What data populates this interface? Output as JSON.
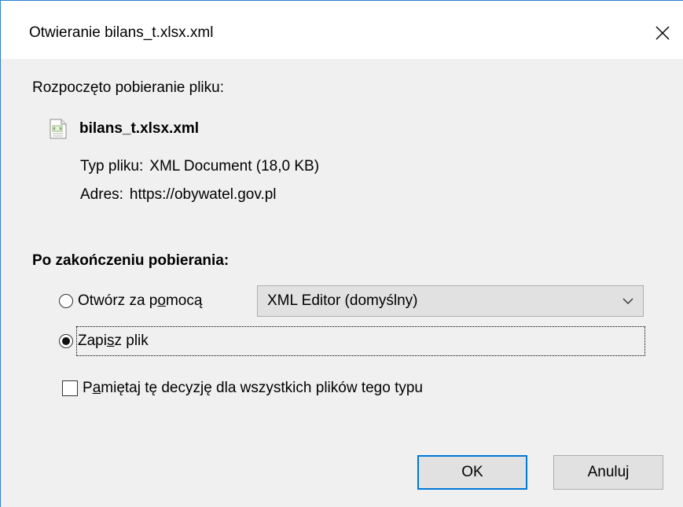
{
  "window": {
    "title": "Otwieranie bilans_t.xlsx.xml",
    "accent_color": "#0078d7"
  },
  "download": {
    "started_label": "Rozpoczęto pobieranie pliku:",
    "file_icon": "xml-file-icon",
    "file_name": "bilans_t.xlsx.xml",
    "type_key": "Typ pliku:",
    "type_value": "XML Document (18,0 KB)",
    "address_key": "Adres:",
    "address_value": "https://obywatel.gov.pl"
  },
  "after_download": {
    "section_label": "Po zakończeniu pobierania:",
    "open_with": {
      "label_pre": "Otwórz za p",
      "label_accel": "o",
      "label_post": "mocą",
      "selected": false
    },
    "open_with_app": "XML Editor (domyślny)",
    "save_file": {
      "label_pre": "Zapi",
      "label_accel": "s",
      "label_post": "z plik",
      "selected": true
    },
    "remember": {
      "label_pre": "P",
      "label_accel": "a",
      "label_post": "miętaj tę decyzję dla wszystkich plików tego typu",
      "checked": false
    }
  },
  "buttons": {
    "ok": "OK",
    "cancel": "Anuluj"
  }
}
